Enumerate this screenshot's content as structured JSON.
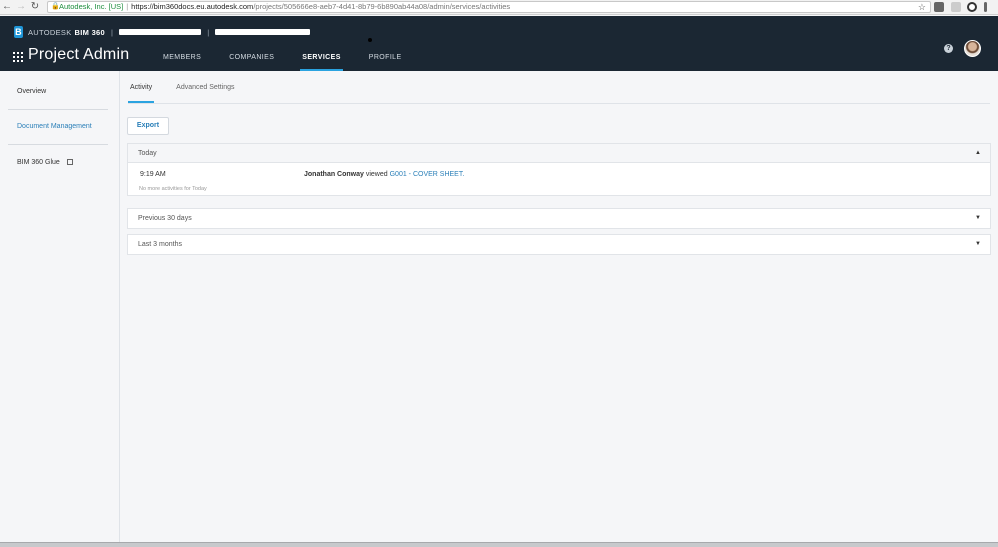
{
  "browser": {
    "secure_label": "Autodesk, Inc. [US]",
    "url_host": "https://bim360docs.eu.autodesk.com",
    "url_path": "/projects/505666e8-aeb7-4d41-8b79-6b890ab44a08/admin/services/activities"
  },
  "header": {
    "brand_company": "AUTODESK",
    "brand_product": "BIM 360",
    "title": "Project Admin",
    "tabs": [
      "MEMBERS",
      "COMPANIES",
      "SERVICES",
      "PROFILE"
    ],
    "active_tab": "SERVICES",
    "help_glyph": "?"
  },
  "sidebar": {
    "items": [
      {
        "label": "Overview"
      },
      {
        "label": "Document Management"
      },
      {
        "label": "BIM 360 Glue"
      }
    ]
  },
  "main": {
    "subtabs": [
      "Activity",
      "Advanced Settings"
    ],
    "export_label": "Export",
    "sections": [
      {
        "title": "Today",
        "expanded": true
      },
      {
        "title": "Previous 30 days",
        "expanded": false
      },
      {
        "title": "Last 3 months",
        "expanded": false
      }
    ],
    "activity": {
      "time": "9:19 AM",
      "user": "Jonathan Conway",
      "verb": "viewed",
      "item": "G001 - COVER SHEET",
      "end": "."
    },
    "no_more": "No more activities for Today"
  },
  "colors": {
    "header_bg": "#1b2733",
    "accent": "#2aa3e0",
    "link": "#2a7fb8"
  }
}
